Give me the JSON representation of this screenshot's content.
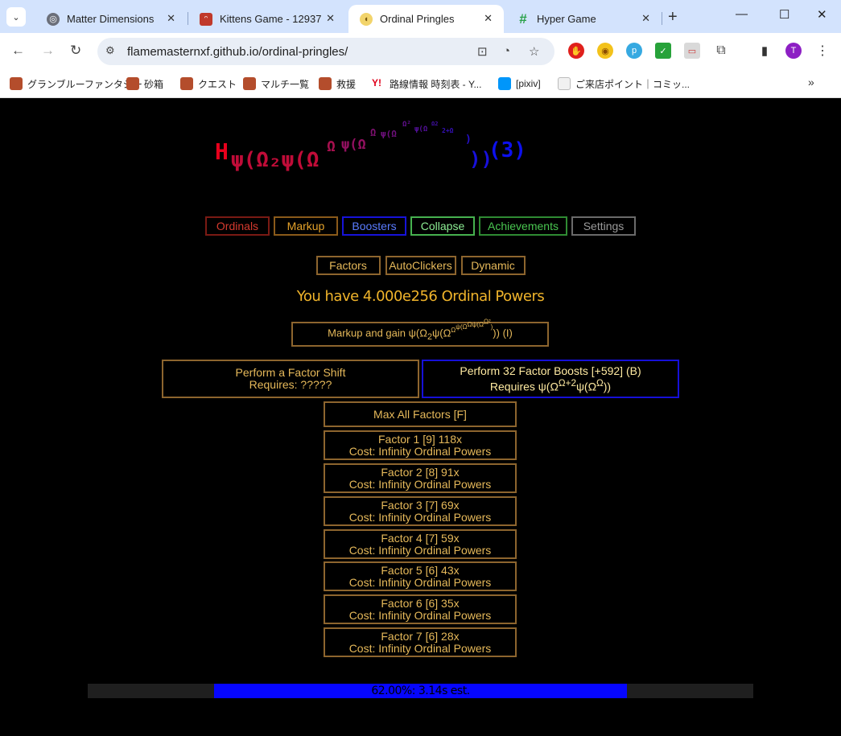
{
  "browser": {
    "tabs": [
      {
        "title": "Matter Dimensions"
      },
      {
        "title": "Kittens Game - 12937 ..."
      },
      {
        "title": "Ordinal Pringles"
      },
      {
        "title": "Hyper Game"
      }
    ],
    "url": "flamemasternxf.github.io/ordinal-pringles/",
    "bookmarks": [
      "グランブルーファンタジー",
      "砂箱",
      "クエスト",
      "マルチ一覧",
      "救援",
      "路線情報 時刻表 - Y...",
      "[pixiv]",
      "ご来店ポイント｜コミッ..."
    ]
  },
  "logo": {
    "h": "H",
    "body": "ψ(Ω₂ψ(Ω",
    "exp1": "Ω",
    "exp2": "ψ(Ω",
    "exp3": "Ω",
    "exp4": "ψ(Ω",
    "exp5": "Ω²",
    "exp6": "ψ(Ω",
    "exp7": "Ω2",
    "exp8": "2+Ω",
    "tail1": ")",
    "tail2": "))",
    "index": "(3)"
  },
  "tabs": {
    "ordinals": "Ordinals",
    "markup": "Markup",
    "boosters": "Boosters",
    "collapse": "Collapse",
    "achievements": "Achievements",
    "settings": "Settings"
  },
  "subtabs": {
    "factors": "Factors",
    "autoclickers": "AutoClickers",
    "dynamic": "Dynamic"
  },
  "powers_text": "You have 4.000e256 Ordinal Powers",
  "markup_button": {
    "prefix": "Markup and gain ψ(Ω",
    "sub": "2",
    "mid": "ψ(Ω",
    "sup": "Ω",
    "sup2": "ψ(Ω",
    "sup3": "Ωψ(Ω",
    "sup4": "Ω²",
    "tail": ")",
    "suffix": ")) (I)"
  },
  "factor_shift": {
    "line1": "Perform a Factor Shift",
    "line2": "Requires: ?????"
  },
  "factor_boost": {
    "line1": "Perform 32 Factor Boosts [+592] (B)",
    "line2_prefix": "Requires ψ(Ω",
    "line2_sup": "Ω+2",
    "line2_mid": "ψ(Ω",
    "line2_sup2": "Ω",
    "line2_suffix": "))"
  },
  "max_all": "Max All Factors [F]",
  "factors": [
    {
      "title": "Factor 1 [9] 118x",
      "cost": "Cost: Infinity Ordinal Powers"
    },
    {
      "title": "Factor 2 [8] 91x",
      "cost": "Cost: Infinity Ordinal Powers"
    },
    {
      "title": "Factor 3 [7] 69x",
      "cost": "Cost: Infinity Ordinal Powers"
    },
    {
      "title": "Factor 4 [7] 59x",
      "cost": "Cost: Infinity Ordinal Powers"
    },
    {
      "title": "Factor 5 [6] 43x",
      "cost": "Cost: Infinity Ordinal Powers"
    },
    {
      "title": "Factor 6 [6] 35x",
      "cost": "Cost: Infinity Ordinal Powers"
    },
    {
      "title": "Factor 7 [6] 28x",
      "cost": "Cost: Infinity Ordinal Powers"
    }
  ],
  "progress": {
    "fraction": 0.62,
    "label": "62.00%: 3.14s est."
  },
  "colors": {
    "ordinals": "#a42a23",
    "markup": "#a36b1d",
    "boosters": "#1713d9",
    "collapse": "#46b14f",
    "achievements": "#2f8b33",
    "settings": "#6a6a6a",
    "gold_text": "#f0b42b",
    "box_border": "#8d652e",
    "progress_fill": "#0606ff"
  }
}
